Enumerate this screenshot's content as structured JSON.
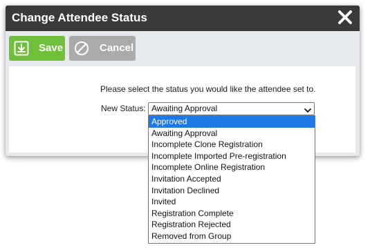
{
  "dialog": {
    "title": "Change Attendee Status"
  },
  "toolbar": {
    "save_label": "Save",
    "cancel_label": "Cancel",
    "save_color": "#6fbf3a",
    "cancel_color": "#aaaaaa"
  },
  "form": {
    "prompt": "Please select the status you would like the attendee set to.",
    "status_label": "New Status:",
    "status_value": "Awaiting Approval"
  },
  "dropdown": {
    "highlighted": "Approved",
    "options": [
      "Approved",
      "Awaiting Approval",
      "Incomplete Clone Registration",
      "Incomplete Imported Pre-registration",
      "Incomplete Online Registration",
      "Invitation Accepted",
      "Invitation Declined",
      "Invited",
      "Registration Complete",
      "Registration Rejected",
      "Removed from Group"
    ]
  },
  "colors": {
    "titlebar": "#3a3a3a",
    "highlight": "#1e78e8"
  },
  "icons": {
    "save": "save-download-icon",
    "cancel": "cancel-circle-slash-icon",
    "close": "close-icon",
    "dropdown": "chevron-down-icon"
  }
}
